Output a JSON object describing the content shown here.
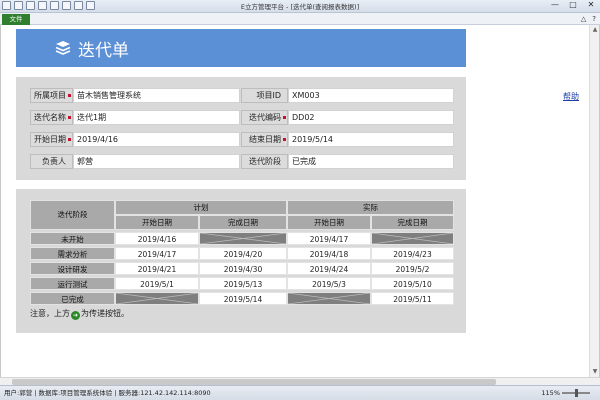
{
  "window": {
    "title": "E立方管理平台 - [迭代单(查阅报表数据)]",
    "min": "—",
    "max": "□",
    "close": "✕"
  },
  "ribbon": {
    "file_tab": "文件",
    "right_icons": [
      "△",
      "?"
    ]
  },
  "page": {
    "title": "迭代单",
    "help": "帮助"
  },
  "form": {
    "project_label": "所属项目",
    "project_value": "苗木销售管理系统",
    "project_id_label": "项目ID",
    "project_id_value": "XM003",
    "iter_name_label": "迭代名称",
    "iter_name_value": "迭代1期",
    "iter_code_label": "迭代编码",
    "iter_code_value": "DD02",
    "start_label": "开始日期",
    "start_value": "2019/4/16",
    "end_label": "结束日期",
    "end_value": "2019/5/14",
    "owner_label": "负责人",
    "owner_value": "郭营",
    "stage_label": "迭代阶段",
    "stage_value": "已完成"
  },
  "progress": {
    "col_stage": "迭代阶段",
    "plan": "计划",
    "actual": "实际",
    "start_date": "开始日期",
    "finish_date": "完成日期",
    "rows": [
      {
        "stage": "未开始",
        "plan_start": "2019/4/16",
        "plan_end": null,
        "act_start": "2019/4/17",
        "act_end": null
      },
      {
        "stage": "需求分析",
        "plan_start": "2019/4/17",
        "plan_end": "2019/4/20",
        "act_start": "2019/4/18",
        "act_end": "2019/4/23"
      },
      {
        "stage": "设计研发",
        "plan_start": "2019/4/21",
        "plan_end": "2019/4/30",
        "act_start": "2019/4/24",
        "act_end": "2019/5/2"
      },
      {
        "stage": "运行测试",
        "plan_start": "2019/5/1",
        "plan_end": "2019/5/13",
        "act_start": "2019/5/3",
        "act_end": "2019/5/10"
      },
      {
        "stage": "已完成",
        "plan_start": null,
        "plan_end": "2019/5/14",
        "act_start": null,
        "act_end": "2019/5/11"
      }
    ],
    "note_before": "注意，上方",
    "note_after": "为传递按钮。"
  },
  "status": {
    "text": "用户:郭营 | 数据库:项目管理系统体验 | 服务器:121.42.142.114:8090",
    "zoom": "115%"
  },
  "colors": {
    "banner": "#5b8fd6",
    "panel": "#d9d9d9",
    "header_cell": "#a9a9a9",
    "na_cell": "#7f7f7f",
    "required_marker": "#c8102e",
    "file_tab": "#2f7f2f"
  }
}
